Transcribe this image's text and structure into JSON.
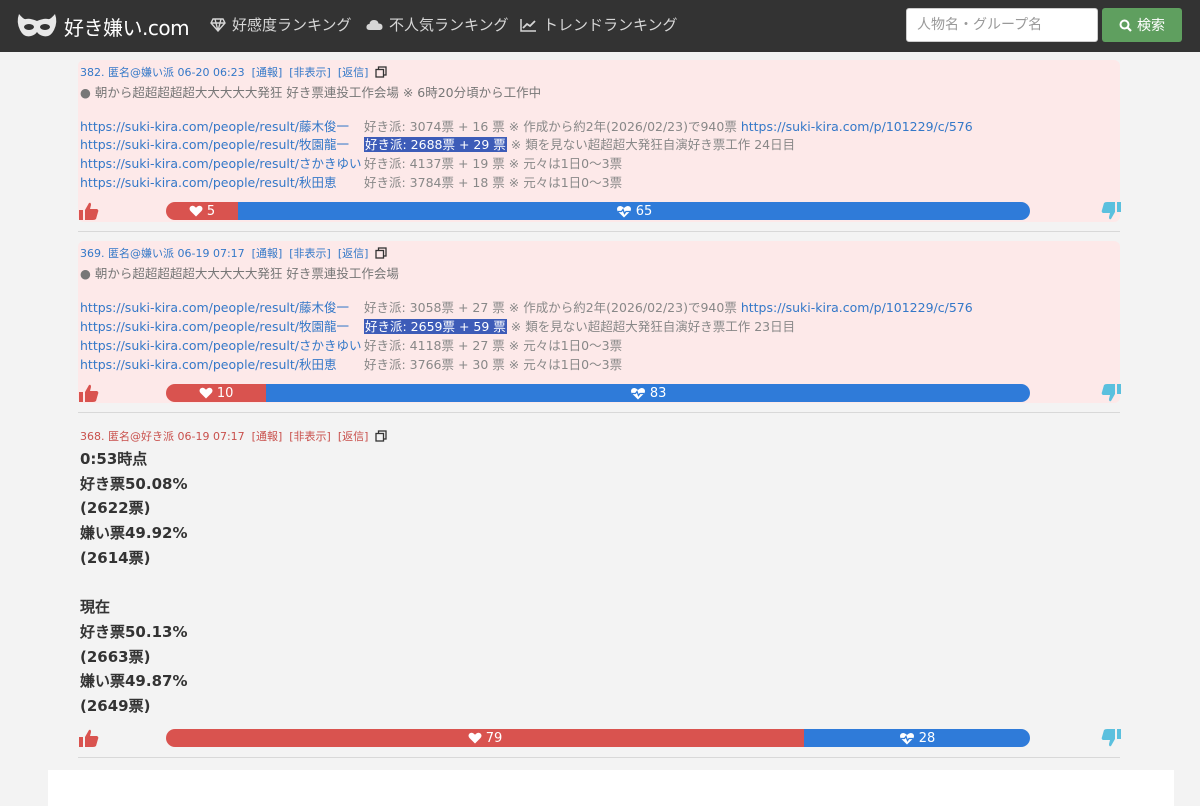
{
  "header": {
    "logo_text": "好き嫌い.com",
    "nav": [
      {
        "label": "好感度ランキング",
        "icon": "diamond-icon"
      },
      {
        "label": "不人気ランキング",
        "icon": "cloud-icon"
      },
      {
        "label": "トレンドランキング",
        "icon": "trend-chart-icon"
      }
    ],
    "search_placeholder": "人物名・グループ名",
    "search_button": "検索"
  },
  "posts": [
    {
      "meta": "382. 匿名@嫌い派 06-20 06:23",
      "report": "[通報]",
      "hide": "[非表示]",
      "reply": "[返信]",
      "text": "● 朝から超超超超超大大大大大発狂 好き票連投工作会場 ※ 6時20分頃から工作中",
      "rows": [
        {
          "link": "https://suki-kira.com/people/result/藤木俊一",
          "stat": "好き派: 3074票 + 16 票",
          "note": " ※ 作成から約2年(2026/02/23)で940票 ",
          "url": "https://suki-kira.com/p/101229/c/576",
          "highlight": false
        },
        {
          "link": "https://suki-kira.com/people/result/牧園龍一",
          "stat": "好き派: 2688票 + 29 票",
          "note": " ※ 類を見ない超超超大発狂自演好き票工作 24日目",
          "url": "",
          "highlight": true
        },
        {
          "link": "https://suki-kira.com/people/result/さかきゆい",
          "stat": "好き派: 4137票 + 19 票",
          "note": " ※ 元々は1日0〜3票",
          "url": "",
          "highlight": false
        },
        {
          "link": "https://suki-kira.com/people/result/秋田恵",
          "stat": "好き派: 3784票 + 18 票",
          "note": " ※ 元々は1日0〜3票",
          "url": "",
          "highlight": false
        }
      ],
      "likes": "5",
      "dislikes": "65",
      "like_fraction": 0.0833
    },
    {
      "meta": "369. 匿名@嫌い派 06-19 07:17",
      "report": "[通報]",
      "hide": "[非表示]",
      "reply": "[返信]",
      "text": "● 朝から超超超超超大大大大大発狂 好き票連投工作会場",
      "rows": [
        {
          "link": "https://suki-kira.com/people/result/藤木俊一",
          "stat": "好き派: 3058票 + 27 票",
          "note": " ※ 作成から約2年(2026/02/23)で940票 ",
          "url": "https://suki-kira.com/p/101229/c/576",
          "highlight": false
        },
        {
          "link": "https://suki-kira.com/people/result/牧園龍一",
          "stat": "好き派: 2659票 + 59 票",
          "note": " ※ 類を見ない超超超大発狂自演好き票工作 23日目",
          "url": "",
          "highlight": true
        },
        {
          "link": "https://suki-kira.com/people/result/さかきゆい",
          "stat": "好き派: 4118票 + 27 票",
          "note": " ※ 元々は1日0〜3票",
          "url": "",
          "highlight": false
        },
        {
          "link": "https://suki-kira.com/people/result/秋田恵",
          "stat": "好き派: 3766票 + 30 票",
          "note": " ※ 元々は1日0〜3票",
          "url": "",
          "highlight": false
        }
      ],
      "likes": "10",
      "dislikes": "83",
      "like_fraction": 0.1161
    },
    {
      "meta": "368. 匿名@好き派 06-19 07:17",
      "report": "[通報]",
      "hide": "[非表示]",
      "reply": "[返信]",
      "lines": [
        "0:53時点",
        "好き票50.08%",
        "(2622票)",
        "嫌い票49.92%",
        "(2614票)",
        "",
        "現在",
        "好き票50.13%",
        "(2663票)",
        "嫌い票49.87%",
        "(2649票)"
      ],
      "likes": "79",
      "dislikes": "28",
      "like_fraction": 0.7384
    }
  ]
}
